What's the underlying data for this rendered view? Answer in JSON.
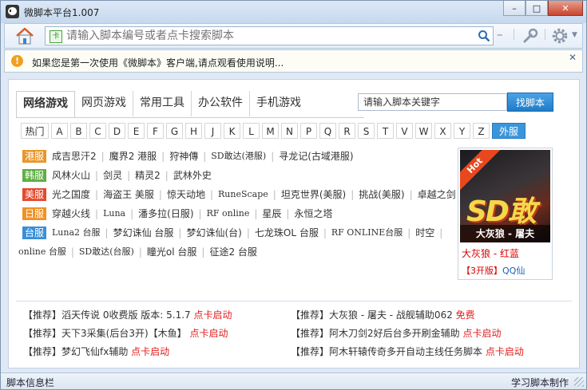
{
  "window": {
    "title": "微脚本平台1.007"
  },
  "toolbar": {
    "search_placeholder": "请输入脚本编号或者点卡搜索脚本",
    "card_icon": "卡"
  },
  "notice": {
    "text": "如果您是第一次使用《微脚本》客户端,请点观看使用说明..."
  },
  "tabs": [
    "网络游戏",
    "网页游戏",
    "常用工具",
    "办公软件",
    "手机游戏"
  ],
  "search": {
    "placeholder": "请输入脚本关键字",
    "button": "找脚本"
  },
  "letters": {
    "hot": "热门",
    "items": [
      "A",
      "B",
      "C",
      "D",
      "E",
      "F",
      "G",
      "H",
      "J",
      "K",
      "L",
      "M",
      "N",
      "P",
      "Q",
      "R",
      "S",
      "T",
      "V",
      "W",
      "X",
      "Y",
      "Z"
    ],
    "selected": "外服"
  },
  "regions": [
    {
      "tag": "港服",
      "color": "#e8962a",
      "games": [
        "成吉思汗2",
        "魔界2 港服",
        "狩神傳",
        "SD敢达(港服)",
        "寻龙记(古域港服)"
      ]
    },
    {
      "tag": "韩服",
      "color": "#5fae45",
      "games": [
        "风林火山",
        "剑灵",
        "精灵2",
        "武林外史"
      ]
    },
    {
      "tag": "美服",
      "color": "#e34a2e",
      "games": [
        "光之国度",
        "海盗王 美服",
        "惊天动地",
        "RuneScape",
        "坦克世界(美服)",
        "挑战(美服)",
        "卓越之剑"
      ]
    },
    {
      "tag": "日服",
      "color": "#f09224",
      "games": [
        "穿越火线",
        "Luna",
        "潘多拉(日服)",
        "RF online",
        "星辰",
        "永恒之塔"
      ]
    },
    {
      "tag": "台服",
      "color": "#3a8fd6",
      "games": [
        "Luna2 台服",
        "梦幻诛仙 台服",
        "梦幻诛仙(台)",
        "七龙珠OL 台服",
        "RF ONLINE台服",
        "时空",
        "online 台服",
        "SD敢达(台服)",
        "瞳光ol 台服",
        "征途2 台服"
      ]
    }
  ],
  "promo": {
    "badge": "Hot",
    "logo": "SD敢",
    "caption": "大灰狼 - 屠夫",
    "line1": "大灰狼 - 红蓝",
    "line2_prefix": "【3开版】",
    "line2_suffix": "QQ仙"
  },
  "recommendations": [
    {
      "prefix": "【推荐】",
      "title": "滔天传说 0收费版 版本: 5.1.7",
      "action": "点卡启动"
    },
    {
      "prefix": "【推荐】",
      "title": "大灰狼 - 屠夫 - 战舰辅助062",
      "action": "免费"
    },
    {
      "prefix": "【推荐】",
      "title": "天下3采集(后台3开)【木鱼】",
      "action": "点卡启动"
    },
    {
      "prefix": "【推荐】",
      "title": "阿木刀剑2好后台多开刷金辅助",
      "action": "点卡启动"
    },
    {
      "prefix": "【推荐】",
      "title": "梦幻飞仙fx辅助",
      "action": "点卡启动"
    },
    {
      "prefix": "【推荐】",
      "title": "阿木轩辕传奇多开自动主线任务脚本",
      "action": "点卡启动"
    }
  ],
  "status": {
    "left": "脚本信息栏",
    "right": "学习脚本制作"
  }
}
